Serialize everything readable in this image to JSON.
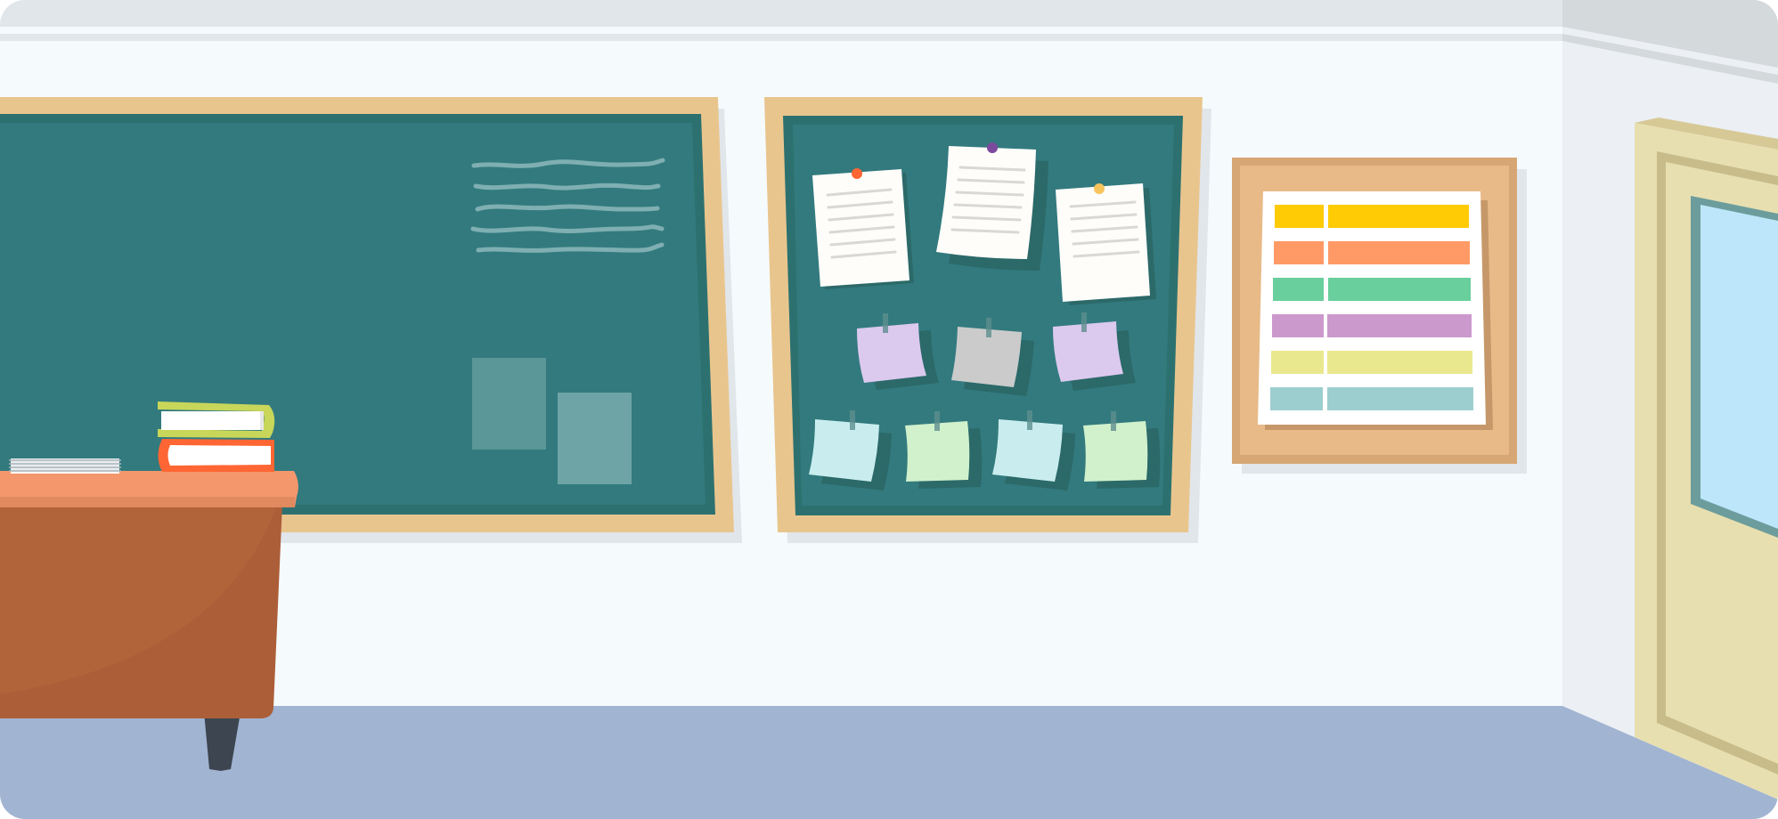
{
  "scene": {
    "kind": "classroom-illustration"
  },
  "colors": {
    "wall": "#F5FBFD",
    "wall_shadow": "#DFE5E9",
    "side_wall": "#ECEFF4",
    "floor": "#A1B4D2",
    "board_frame": "#E9C58E",
    "board_inner": "#2C716F",
    "board_surface": "#327A7E",
    "desk_top": "#F4976D",
    "desk_front": "#AC5E38",
    "door_frame": "#E8DFB0",
    "door_window": "#BEE6FA",
    "schedule_frame": "#E8BA88",
    "schedule_rows": [
      "#FFCB05",
      "#FF9A66",
      "#69CF9D",
      "#CC99CC",
      "#EAE88E",
      "#9DCECF"
    ],
    "pin_colors": [
      "#FF6633",
      "#7B4A9E",
      "#F8C45C"
    ],
    "sticky_colors": [
      "#DBC9EE",
      "#CBCBCB",
      "#DBC9EE",
      "#C9EDEE",
      "#D0F1CB",
      "#C9EDEE",
      "#D0F1CB"
    ]
  },
  "icons": {
    "chalkboard": "chalkboard-icon",
    "corkboard": "corkboard-icon",
    "schedule": "schedule-chart-icon",
    "door": "door-icon",
    "desk": "teacher-desk-icon",
    "books": "book-stack-icon",
    "papers": "paper-stack-icon"
  }
}
